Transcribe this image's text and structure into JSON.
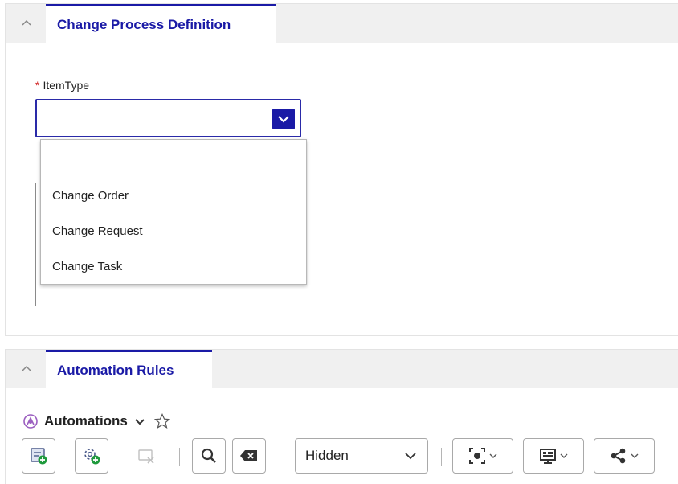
{
  "section1": {
    "tab_label": "Change Process Definition",
    "field": {
      "required_mark": "*",
      "label": "ItemType",
      "value": ""
    },
    "dropdown_options": [
      "",
      "Change Order",
      "Change Request",
      "Change Task"
    ]
  },
  "section2": {
    "tab_label": "Automation Rules",
    "list_title": "Automations",
    "toolbar": {
      "hidden_select_value": "Hidden"
    }
  },
  "colors": {
    "accent": "#1a1aa6",
    "required": "#d02020",
    "header_bg": "#f0f0f0"
  },
  "icons": [
    "collapse-chevron-icon",
    "dropdown-chevron-icon",
    "automations-icon",
    "star-icon",
    "new-record-icon",
    "add-gear-icon",
    "clear-selection-icon",
    "search-icon",
    "clear-filter-icon",
    "record-view-icon",
    "display-icon",
    "share-icon"
  ]
}
